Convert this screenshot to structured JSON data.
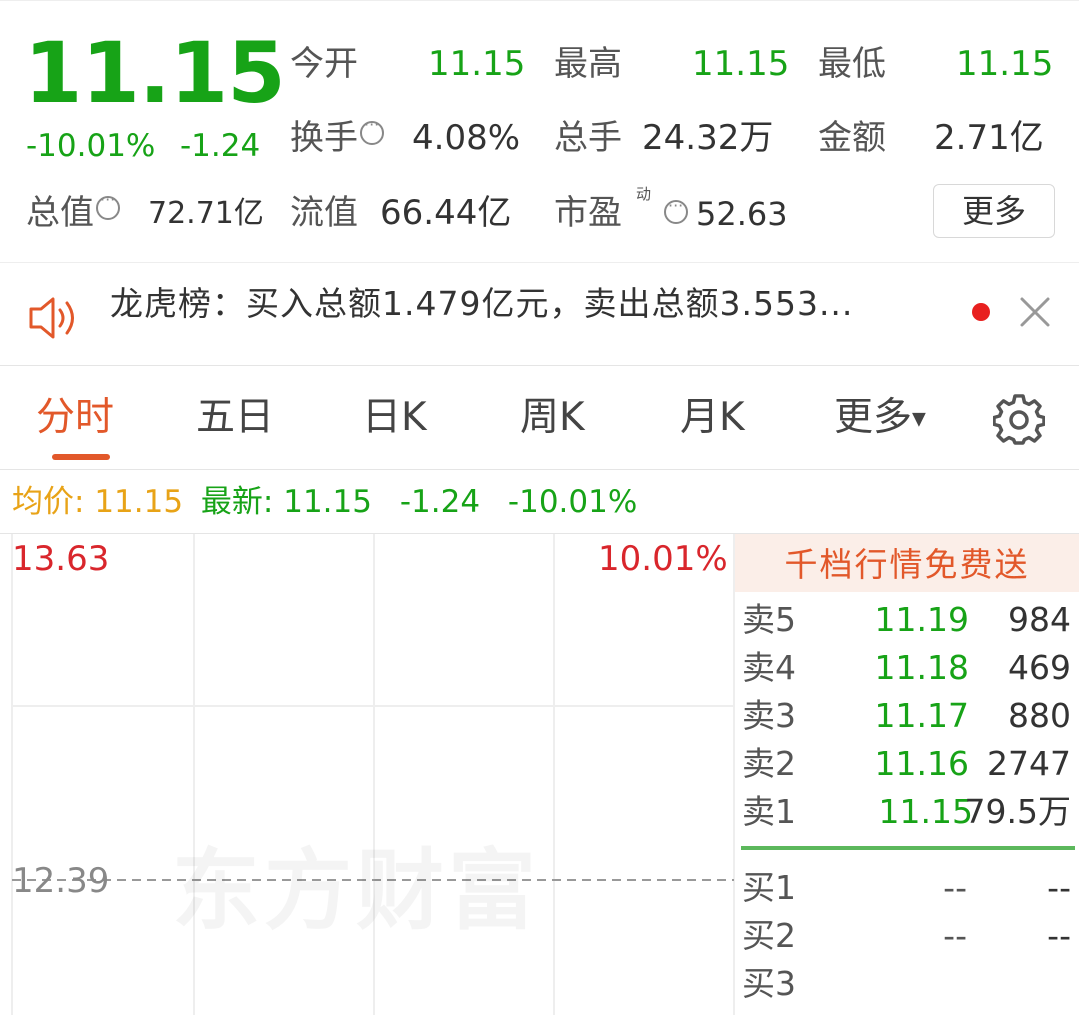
{
  "quote": {
    "price": "11.15",
    "change_pct": "-10.01%",
    "change_abs": "-1.24",
    "fields": {
      "open_label": "今开",
      "open_value": "11.15",
      "high_label": "最高",
      "high_value": "11.15",
      "low_label": "最低",
      "low_value": "11.15",
      "turnover_label": "换手",
      "turnover_value": "4.08%",
      "volume_label": "总手",
      "volume_value": "24.32万",
      "amount_label": "金额",
      "amount_value": "2.71亿",
      "mktcap_label": "总值",
      "mktcap_value": "72.71亿",
      "float_label": "流值",
      "float_value": "66.44亿",
      "pe_label": "市盈",
      "pe_sup": "动",
      "pe_value": "52.63"
    },
    "more_label": "更多"
  },
  "notice": {
    "text": "龙虎榜：买入总额1.479亿元，卖出总额3.553...",
    "icon": "speaker-icon"
  },
  "tabs": {
    "items": [
      "分时",
      "五日",
      "日K",
      "周K",
      "月K"
    ],
    "more_label": "更多",
    "active": 0
  },
  "status": {
    "avg_label": "均价:",
    "avg_value": "11.15",
    "latest_label": "最新:",
    "latest_value": "11.15",
    "change_abs": "-1.24",
    "change_pct": "-10.01%"
  },
  "chart": {
    "top_price": "13.63",
    "top_pct": "10.01%",
    "mid_label": "12.39",
    "watermark": "东方财富"
  },
  "book": {
    "promo": "千档行情免费送",
    "asks": [
      {
        "label": "卖5",
        "price": "11.19",
        "volume": "984"
      },
      {
        "label": "卖4",
        "price": "11.18",
        "volume": "469"
      },
      {
        "label": "卖3",
        "price": "11.17",
        "volume": "880"
      },
      {
        "label": "卖2",
        "price": "11.16",
        "volume": "2747"
      },
      {
        "label": "卖1",
        "price": "11.15",
        "volume": "79.5万"
      }
    ],
    "bids": [
      {
        "label": "买1",
        "price": "--",
        "volume": "--"
      },
      {
        "label": "买2",
        "price": "--",
        "volume": "--"
      },
      {
        "label": "买3",
        "price": "",
        "volume": ""
      }
    ]
  },
  "colors": {
    "up": "#d9262c",
    "down": "#17a317",
    "accent": "#e2582a",
    "avg": "#e8a317"
  }
}
